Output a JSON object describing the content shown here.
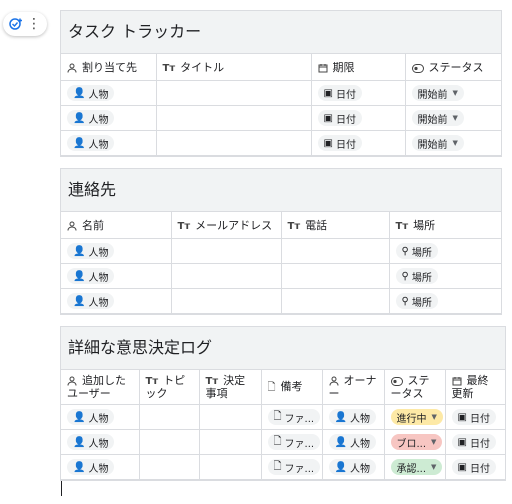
{
  "float_button": {
    "icon": "add-task-icon",
    "more_icon": "more-vert-icon"
  },
  "table1": {
    "title": "タスク トラッカー",
    "headers": {
      "assignee": "割り当て先",
      "title": "タイトル",
      "due": "期限",
      "status": "ステータス"
    },
    "header_icons": {
      "assignee": "person-icon",
      "title": "text-icon",
      "due": "calendar-icon",
      "status": "status-icon"
    },
    "rows": [
      {
        "assignee": "人物",
        "title": "",
        "due": "日付",
        "status": "開始前"
      },
      {
        "assignee": "人物",
        "title": "",
        "due": "日付",
        "status": "開始前"
      },
      {
        "assignee": "人物",
        "title": "",
        "due": "日付",
        "status": "開始前"
      }
    ]
  },
  "table2": {
    "title": "連絡先",
    "headers": {
      "name": "名前",
      "email": "メールアドレス",
      "phone": "電話",
      "place": "場所"
    },
    "rows": [
      {
        "name": "人物",
        "email": "",
        "phone": "",
        "place": "場所"
      },
      {
        "name": "人物",
        "email": "",
        "phone": "",
        "place": "場所"
      },
      {
        "name": "人物",
        "email": "",
        "phone": "",
        "place": "場所"
      }
    ]
  },
  "table3": {
    "title": "詳細な意思決定ログ",
    "headers": {
      "added_by": "追加した ユーザー",
      "topic": "トピック",
      "decision": "決定事項",
      "notes": "備考",
      "owner": "オーナー",
      "status": "ステータス",
      "updated": "最終更新"
    },
    "rows": [
      {
        "added_by": "人物",
        "notes": "ファ...",
        "owner": "人物",
        "status": "進行中",
        "status_color": "#fde9a6",
        "updated": "日付"
      },
      {
        "added_by": "人物",
        "notes": "ファ...",
        "owner": "人物",
        "status": "ブロ...",
        "status_color": "#f7c6c2",
        "updated": "日付"
      },
      {
        "added_by": "人物",
        "notes": "ファ...",
        "owner": "人物",
        "status": "承認...",
        "status_color": "#cdebd3",
        "updated": "日付"
      }
    ]
  }
}
